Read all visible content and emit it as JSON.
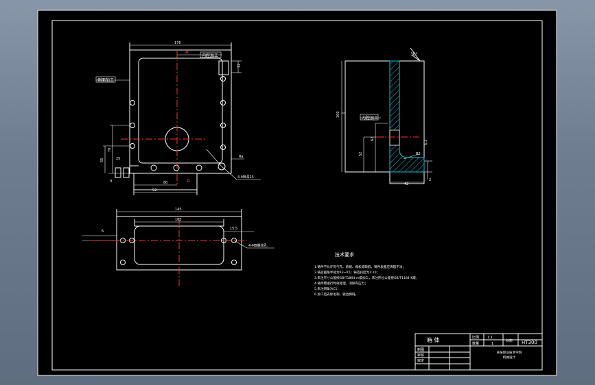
{
  "colors": {
    "paper": "#000000",
    "line": "#ffffff",
    "center": "#ff0000",
    "hatch": "#00c8d8",
    "accent": "#e83a3a",
    "gray": "#9aa4b0"
  },
  "dims": {
    "top_width": "176",
    "left_box": "侧面加工",
    "top_box": "内腔加工",
    "right_top": "32",
    "left_v1": "70",
    "left_v2": "55",
    "left_v3": "25",
    "left_v4": "0",
    "bottom_h1": "80",
    "bottom_h2": "52",
    "hole_note": "4-M8深15",
    "section_a_top": "A",
    "section_a_bot": "A",
    "bottom_width_outer": "145",
    "bottom_width_inner": "102",
    "bottom_right": "15.5",
    "bottom_left": "6",
    "bottom_note": "4-M8螺纹孔",
    "side_angle": "30°",
    "side_height": "100",
    "side_box": "内腔加工",
    "side_h1": "52",
    "side_h2": "62",
    "side_r": "R5",
    "side_bottom": "42",
    "side_small": "2",
    "side_ra": "6.3"
  },
  "tech": {
    "title": "技术要求",
    "lines": [
      "1.铸件不允许有气孔、砂眼、缩松等缺陷，铸件表面应清理干净；",
      "2.铸造圆角半径为R3~R5；铸造斜度为1:20；",
      "3.未注尺寸公差按GB/T1804-m级加工，未注形位公差按GB/T1184-K级；",
      "4.铸件需进行时效处理，消除内应力；",
      "5.未注倒角为C1；",
      "6.加工后去除毛刺，锐边倒钝。"
    ]
  },
  "title_block": {
    "name": "箱  体",
    "scale_label": "比例",
    "scale_value": "1:1",
    "qty_label": "数量",
    "qty_value": "1",
    "material_label": "材料",
    "material": "HT300",
    "r1_label": "制图",
    "r2_label": "审核",
    "r3_label": "审定",
    "school": "某某职业技术学院",
    "class": "机械设计"
  }
}
